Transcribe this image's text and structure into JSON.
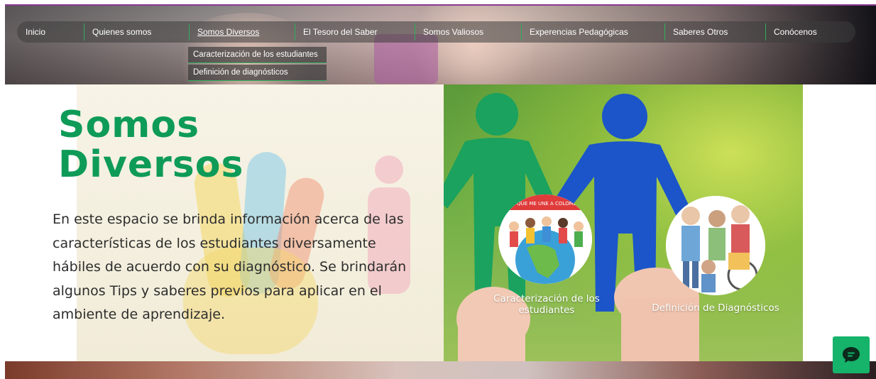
{
  "nav": {
    "items": [
      {
        "label": "Inicio"
      },
      {
        "label": "Quienes somos"
      },
      {
        "label": "Somos Diversos"
      },
      {
        "label": "El Tesoro del Saber"
      },
      {
        "label": "Somos Valiosos"
      },
      {
        "label": "Experencias Pedagógicas"
      },
      {
        "label": "Saberes Otros"
      },
      {
        "label": "Conócenos"
      }
    ],
    "dropdown": [
      {
        "label": "Caracterización de los estudiantes"
      },
      {
        "label": "Definición de diagnósticos"
      }
    ]
  },
  "hero": {
    "title_line1": "Somos",
    "title_line2": "Diversos",
    "description": "En este espacio se brinda información acerca de las características de los estudiantes diversamente hábiles de acuerdo con su diagnóstico. Se brindarán algunos Tips y saberes previos para aplicar en el ambiente de aprendizaje."
  },
  "cards": [
    {
      "label": "Caracterización de los estudiantes",
      "image_caption": "LO QUE ME UNE A COLOMBIA"
    },
    {
      "label": "Definición de Diagnósticos"
    }
  ],
  "colors": {
    "accent_green": "#0e9b58",
    "chat_green": "#16b36a",
    "nav_separator": "#2fae5a"
  },
  "icons": {
    "chat": "chat-bubble-icon"
  }
}
